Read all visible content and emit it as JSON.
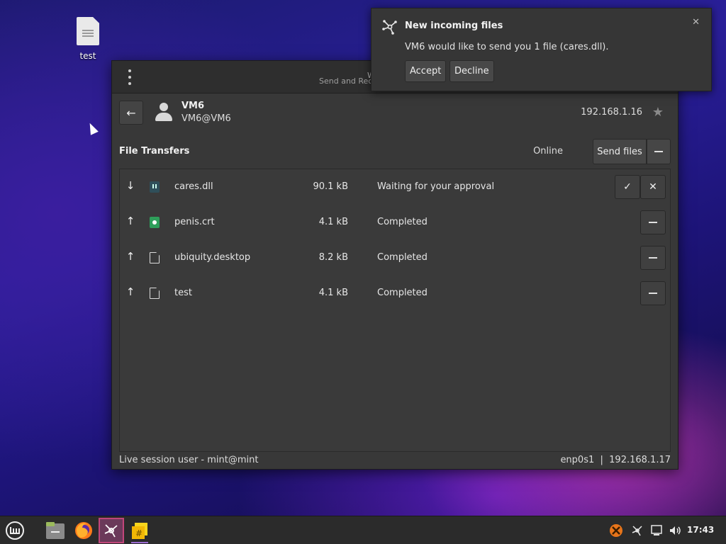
{
  "desktop": {
    "icon_label": "test"
  },
  "window": {
    "title": "W",
    "subtitle": "Send and Rece",
    "peer": {
      "name": "VM6",
      "user": "VM6@VM6",
      "ip": "192.168.1.16"
    },
    "transfers_title": "File Transfers",
    "status": "Online",
    "send_files_label": "Send files",
    "files": [
      {
        "direction": "down",
        "icon": "binary-file-icon",
        "name": "cares.dll",
        "size": "90.1 kB",
        "status": "Waiting for your approval"
      },
      {
        "direction": "up",
        "icon": "certificate-file-icon",
        "name": "penis.crt",
        "size": "4.1 kB",
        "status": "Completed"
      },
      {
        "direction": "up",
        "icon": "text-file-icon",
        "name": "ubiquity.desktop",
        "size": "8.2 kB",
        "status": "Completed"
      },
      {
        "direction": "up",
        "icon": "text-file-icon",
        "name": "test",
        "size": "4.1 kB",
        "status": "Completed"
      }
    ],
    "statusbar": {
      "left": "Live session user - mint@mint",
      "right": "enp0s1  |  192.168.1.17"
    }
  },
  "notification": {
    "title": "New incoming files",
    "body": "VM6 would like to send you 1 file (cares.dll).",
    "accept_label": "Accept",
    "decline_label": "Decline"
  },
  "taskbar": {
    "clock": "17:43",
    "apps": [
      "mint-menu-icon",
      "files-icon",
      "firefox-icon",
      "warpinator-icon",
      "notes-icon"
    ],
    "tray": [
      "update-icon",
      "network-share-icon",
      "network-icon",
      "volume-icon"
    ]
  }
}
